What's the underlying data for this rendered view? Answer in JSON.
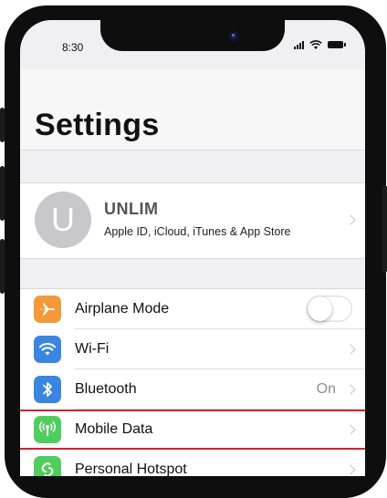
{
  "status_bar": {
    "time": "8:30"
  },
  "header": {
    "title": "Settings"
  },
  "profile": {
    "initial": "U",
    "name": "UNLIM",
    "subtitle": "Apple ID, iCloud, iTunes & App Store"
  },
  "settings": {
    "items": [
      {
        "label": "Airplane Mode",
        "icon": "airplane-icon",
        "color": "#f4993a",
        "toggle_on": false
      },
      {
        "label": "Wi-Fi",
        "icon": "wifi-icon",
        "color": "#3a85e0"
      },
      {
        "label": "Bluetooth",
        "icon": "bluetooth-icon",
        "color": "#3a85e0",
        "value": "On"
      },
      {
        "label": "Mobile Data",
        "icon": "antenna-icon",
        "color": "#4fcd5d",
        "highlighted": true
      },
      {
        "label": "Personal Hotspot",
        "icon": "hotspot-icon",
        "color": "#4fcd5d"
      }
    ]
  },
  "colors": {
    "highlight": "#d6202e",
    "background": "#efeff4"
  }
}
